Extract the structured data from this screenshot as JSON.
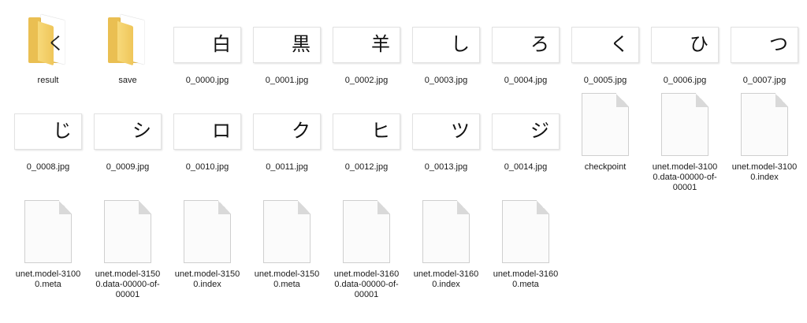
{
  "window": {
    "title": ""
  },
  "items": [
    {
      "kind": "folder",
      "name": "result",
      "glyph": "く"
    },
    {
      "kind": "folder",
      "name": "save",
      "glyph": ""
    },
    {
      "kind": "image",
      "name": "0_0000.jpg",
      "char": "白"
    },
    {
      "kind": "image",
      "name": "0_0001.jpg",
      "char": "黒"
    },
    {
      "kind": "image",
      "name": "0_0002.jpg",
      "char": "羊"
    },
    {
      "kind": "image",
      "name": "0_0003.jpg",
      "char": "し"
    },
    {
      "kind": "image",
      "name": "0_0004.jpg",
      "char": "ろ"
    },
    {
      "kind": "image",
      "name": "0_0005.jpg",
      "char": "く"
    },
    {
      "kind": "image",
      "name": "0_0006.jpg",
      "char": "ひ"
    },
    {
      "kind": "image",
      "name": "0_0007.jpg",
      "char": "つ"
    },
    {
      "kind": "image",
      "name": "0_0008.jpg",
      "char": "じ"
    },
    {
      "kind": "image",
      "name": "0_0009.jpg",
      "char": "シ"
    },
    {
      "kind": "image",
      "name": "0_0010.jpg",
      "char": "ロ"
    },
    {
      "kind": "image",
      "name": "0_0011.jpg",
      "char": "ク"
    },
    {
      "kind": "image",
      "name": "0_0012.jpg",
      "char": "ヒ"
    },
    {
      "kind": "image",
      "name": "0_0013.jpg",
      "char": "ツ"
    },
    {
      "kind": "image",
      "name": "0_0014.jpg",
      "char": "ジ"
    },
    {
      "kind": "file",
      "name": "checkpoint"
    },
    {
      "kind": "file",
      "name": "unet.model-3100\n0.data-00000-of-\n00001"
    },
    {
      "kind": "file",
      "name": "unet.model-3100\n0.index"
    },
    {
      "kind": "file",
      "name": "unet.model-3100\n0.meta"
    },
    {
      "kind": "file",
      "name": "unet.model-3150\n0.data-00000-of-\n00001"
    },
    {
      "kind": "file",
      "name": "unet.model-3150\n0.index"
    },
    {
      "kind": "file",
      "name": "unet.model-3150\n0.meta"
    },
    {
      "kind": "file",
      "name": "unet.model-3160\n0.data-00000-of-\n00001"
    },
    {
      "kind": "file",
      "name": "unet.model-3160\n0.index"
    },
    {
      "kind": "file",
      "name": "unet.model-3160\n0.meta"
    }
  ]
}
